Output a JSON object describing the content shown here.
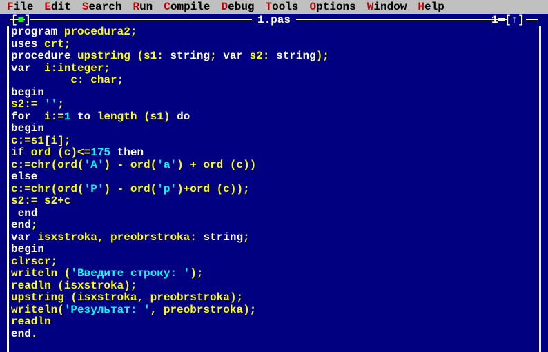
{
  "menu": {
    "items": [
      {
        "hot": "F",
        "rest": "ile"
      },
      {
        "hot": "E",
        "rest": "dit"
      },
      {
        "hot": "S",
        "rest": "earch"
      },
      {
        "hot": "R",
        "rest": "un"
      },
      {
        "hot": "C",
        "rest": "ompile"
      },
      {
        "hot": "D",
        "rest": "ebug"
      },
      {
        "hot": "T",
        "rest": "ools"
      },
      {
        "hot": "O",
        "rest": "ptions"
      },
      {
        "hot": "W",
        "rest": "indow"
      },
      {
        "hot": "H",
        "rest": "elp"
      }
    ]
  },
  "window": {
    "close_glyph": "■",
    "title": " 1.pas ",
    "number": "1",
    "arrow": "↑"
  },
  "code": [
    [
      [
        "kw",
        "program"
      ],
      [
        "id",
        " procedura2;"
      ]
    ],
    [
      [
        "kw",
        "uses"
      ],
      [
        "id",
        " crt;"
      ]
    ],
    [
      [
        "kw",
        "procedure"
      ],
      [
        "id",
        " upstring (s1: "
      ],
      [
        "kw",
        "string"
      ],
      [
        "id",
        "; "
      ],
      [
        "kw",
        "var"
      ],
      [
        "id",
        " s2: "
      ],
      [
        "kw",
        "string"
      ],
      [
        "id",
        ");"
      ]
    ],
    [
      [
        "kw",
        "var"
      ],
      [
        "id",
        "  i:integer;"
      ]
    ],
    [
      [
        "id",
        "         c: char;"
      ]
    ],
    [
      [
        "kw",
        "begin"
      ]
    ],
    [
      [
        "id",
        "s2:= "
      ],
      [
        "str",
        "''"
      ],
      [
        "id",
        ";"
      ]
    ],
    [
      [
        "kw",
        "for"
      ],
      [
        "id",
        "  i:="
      ],
      [
        "num",
        "1"
      ],
      [
        "id",
        " "
      ],
      [
        "kw",
        "to"
      ],
      [
        "id",
        " length (s1) "
      ],
      [
        "kw",
        "do"
      ]
    ],
    [
      [
        "kw",
        "begin"
      ]
    ],
    [
      [
        "id",
        "c:=s1[i];"
      ]
    ],
    [
      [
        "kw",
        "if"
      ],
      [
        "id",
        " ord (c)<="
      ],
      [
        "num",
        "175"
      ],
      [
        "id",
        " "
      ],
      [
        "kw",
        "then"
      ]
    ],
    [
      [
        "id",
        "c:=chr(ord("
      ],
      [
        "str",
        "'А'"
      ],
      [
        "id",
        ") - ord("
      ],
      [
        "str",
        "'а'"
      ],
      [
        "id",
        ") + ord (c))"
      ]
    ],
    [
      [
        "kw",
        "else"
      ]
    ],
    [
      [
        "id",
        "c:=chr(ord("
      ],
      [
        "str",
        "'Р'"
      ],
      [
        "id",
        ") - ord("
      ],
      [
        "str",
        "'р'"
      ],
      [
        "id",
        ")+ord (c));"
      ]
    ],
    [
      [
        "id",
        "s2:= s2+c"
      ]
    ],
    [
      [
        "id",
        " "
      ],
      [
        "kw",
        "end"
      ]
    ],
    [
      [
        "kw",
        "end"
      ],
      [
        "id",
        ";"
      ]
    ],
    [
      [
        "kw",
        "var"
      ],
      [
        "id",
        " isxstroka, preobrstroka: "
      ],
      [
        "kw",
        "string"
      ],
      [
        "id",
        ";"
      ]
    ],
    [
      [
        "kw",
        "begin"
      ]
    ],
    [
      [
        "id",
        "clrscr;"
      ]
    ],
    [
      [
        "id",
        "writeln ("
      ],
      [
        "str",
        "'Введите строку: '"
      ],
      [
        "id",
        ");"
      ]
    ],
    [
      [
        "id",
        "readln (isxstroka);"
      ]
    ],
    [
      [
        "id",
        "upstring (isxstroka, preobrstroka);"
      ]
    ],
    [
      [
        "id",
        "writeln("
      ],
      [
        "str",
        "'Результат: '"
      ],
      [
        "id",
        ", preobrstroka);"
      ]
    ],
    [
      [
        "id",
        "readln"
      ]
    ],
    [
      [
        "kw",
        "end"
      ],
      [
        "id",
        "."
      ]
    ]
  ]
}
